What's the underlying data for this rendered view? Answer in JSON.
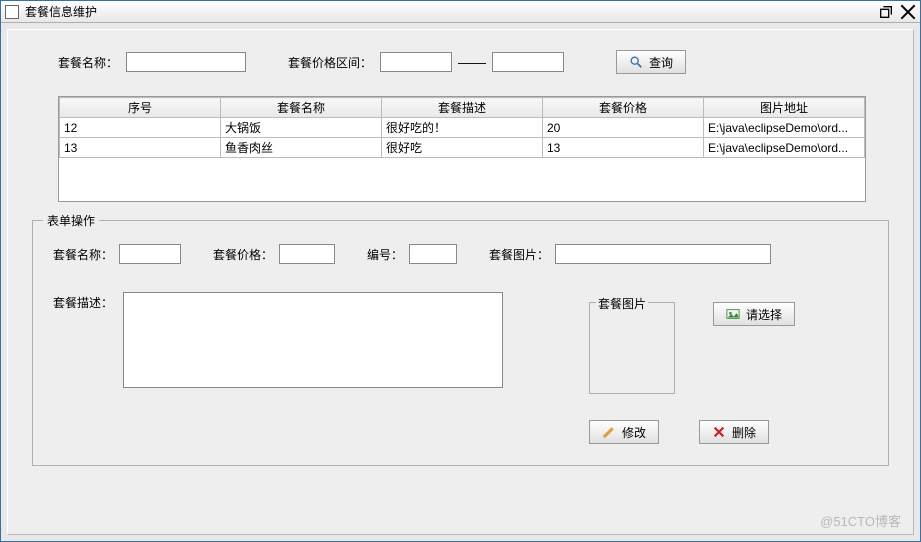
{
  "window": {
    "title": "套餐信息维护"
  },
  "search": {
    "name_label": "套餐名称：",
    "name_value": "",
    "range_label": "套餐价格区间：",
    "range_from": "",
    "range_to": "",
    "dash": "——",
    "query_btn": "查询"
  },
  "table": {
    "headers": [
      "序号",
      "套餐名称",
      "套餐描述",
      "套餐价格",
      "图片地址"
    ],
    "rows": [
      [
        "12",
        "大锅饭",
        "很好吃的！",
        "20",
        "E:\\java\\eclipseDemo\\ord..."
      ],
      [
        "13",
        "鱼香肉丝",
        "很好吃",
        "13",
        "E:\\java\\eclipseDemo\\ord..."
      ]
    ]
  },
  "form": {
    "group_title": "表单操作",
    "name_label": "套餐名称：",
    "name_value": "",
    "price_label": "套餐价格：",
    "price_value": "",
    "id_label": "编号：",
    "id_value": "",
    "image_label": "套餐图片：",
    "image_value": "",
    "desc_label": "套餐描述：",
    "desc_value": "",
    "image_group": "套餐图片",
    "choose_btn": "请选择",
    "modify_btn": "修改",
    "delete_btn": "删除"
  },
  "watermark": "@51CTO博客"
}
